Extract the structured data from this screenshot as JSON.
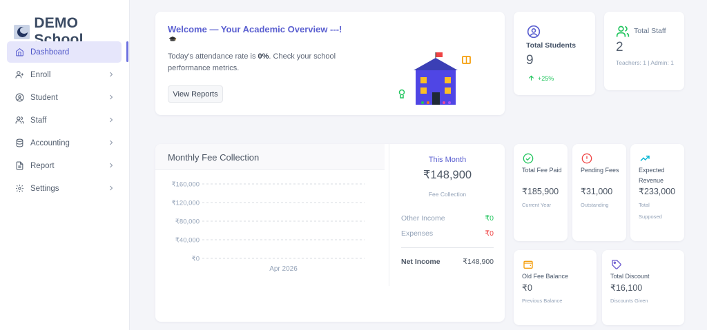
{
  "brand": {
    "name": "DEMO School"
  },
  "nav": {
    "items": [
      {
        "label": "Dashboard",
        "icon": "home-icon"
      },
      {
        "label": "Enroll",
        "icon": "user-plus-icon"
      },
      {
        "label": "Student",
        "icon": "user-circle-icon"
      },
      {
        "label": "Staff",
        "icon": "users-icon"
      },
      {
        "label": "Accounting",
        "icon": "database-icon"
      },
      {
        "label": "Report",
        "icon": "file-icon"
      },
      {
        "label": "Settings",
        "icon": "gear-icon"
      }
    ]
  },
  "welcome": {
    "title": "Welcome — Your Academic Overview ---!",
    "text_prefix": "Today's attendance rate is ",
    "rate": "0%",
    "text_suffix": ". Check your school performance metrics.",
    "button": "View Reports"
  },
  "students": {
    "label": "Total Students",
    "value": "9",
    "trend": "+25%"
  },
  "staff": {
    "label": "Total Staff",
    "value": "2",
    "sub": "Teachers: 1 | Admin: 1"
  },
  "fee": {
    "title": "Monthly Fee Collection",
    "this_month_label": "This Month",
    "this_month_amount": "₹148,900",
    "this_month_sub": "Fee Collection",
    "other_income_label": "Other Income",
    "other_income_value": "₹0",
    "expenses_label": "Expenses",
    "expenses_value": "₹0",
    "net_income_label": "Net Income",
    "net_income_value": "₹148,900"
  },
  "chart_data": {
    "type": "bar",
    "categories": [
      "Apr 2026"
    ],
    "values": [
      0
    ],
    "yticks": [
      "₹160,000",
      "₹120,000",
      "₹80,000",
      "₹40,000",
      "₹0"
    ],
    "ylim": [
      0,
      160000
    ],
    "grid": true
  },
  "mini_cards": {
    "fee_paid": {
      "label": "Total Fee Paid",
      "value": "₹185,900",
      "sub": "Current Year"
    },
    "pending": {
      "label": "Pending Fees",
      "value": "₹31,000",
      "sub": "Outstanding"
    },
    "revenue": {
      "label": "Expected Revenue",
      "value": "₹233,000",
      "sub": "Total Supposed"
    },
    "old_fee": {
      "label": "Old Fee Balance",
      "value": "₹0",
      "sub": "Previous Balance"
    },
    "discount": {
      "label": "Total Discount",
      "value": "₹16,100",
      "sub": "Discounts Given"
    }
  },
  "colors": {
    "accent": "#5a5fd0",
    "success": "#22c55e",
    "danger": "#ef4444",
    "warning": "#f59e0b",
    "brand_dark": "#3b4b63"
  }
}
